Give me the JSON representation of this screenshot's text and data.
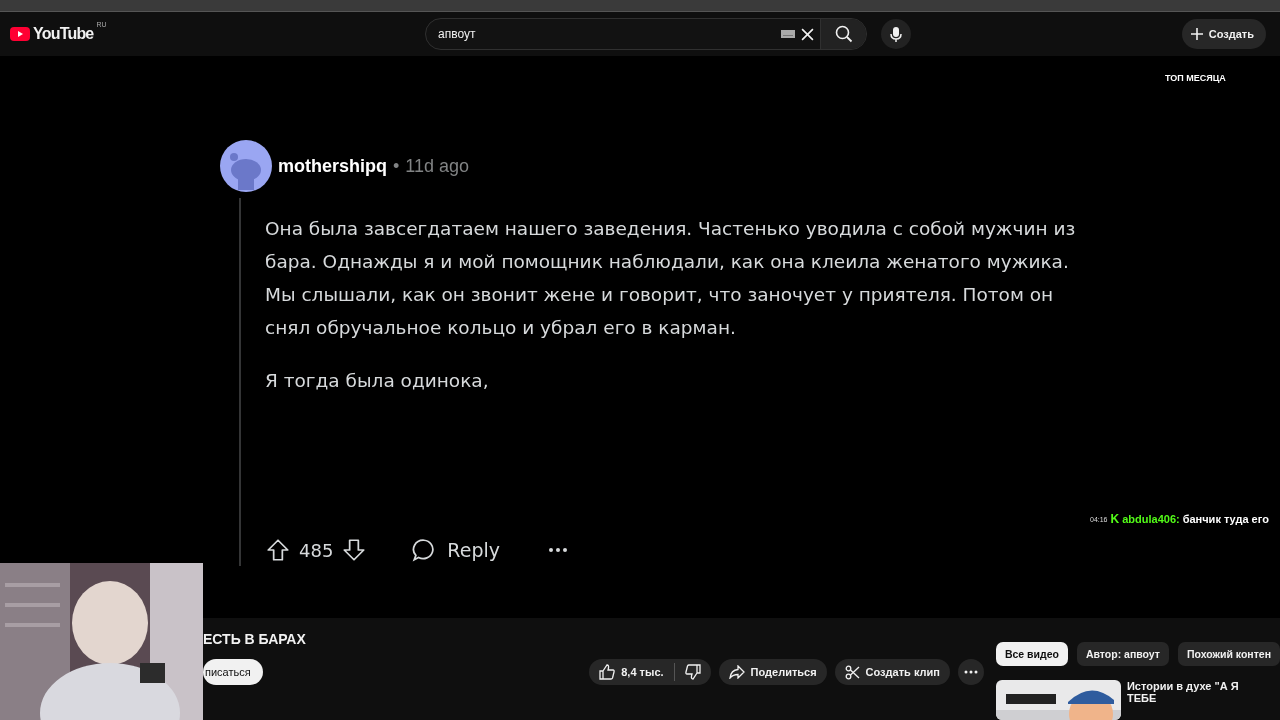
{
  "header": {
    "logo": "YouTube",
    "region": "RU",
    "search": {
      "value": "апвоут"
    },
    "create_button": "Создать"
  },
  "video": {
    "overlay_label": "ТОП МЕСЯЦА",
    "comment": {
      "author": "mothershipq",
      "separator": "•",
      "age": "11d ago",
      "paragraphs": [
        "Она была завсегдатаем нашего заведения. Частенько уводила с собой мужчин из бара. Однажды я и мой помощник наблюдали, как она клеила женатого мужика. Мы слышали, как он звонит жене и говорит, что заночует у приятеля. Потом он снял обручальное кольцо и убрал его в карман.",
        "Я тогда была одинока,"
      ],
      "score": "485",
      "reply": "Reply"
    },
    "chat": {
      "time": "04:16",
      "badge": "K",
      "user": "abdula406:",
      "message": "банчик туда его"
    }
  },
  "below": {
    "title": "ЕСТЬ В БАРАХ",
    "subscribe": "писаться",
    "likes": "8,4 тыс.",
    "share": "Поделиться",
    "clip": "Создать клип"
  },
  "sidebar": {
    "chips": [
      {
        "label": "Все видео",
        "selected": true
      },
      {
        "label": "Автор: апвоут",
        "selected": false
      },
      {
        "label": "Похожий контен",
        "selected": false
      }
    ],
    "videos": [
      {
        "title": "Истории в духе \"А Я ТЕБЕ"
      }
    ]
  }
}
